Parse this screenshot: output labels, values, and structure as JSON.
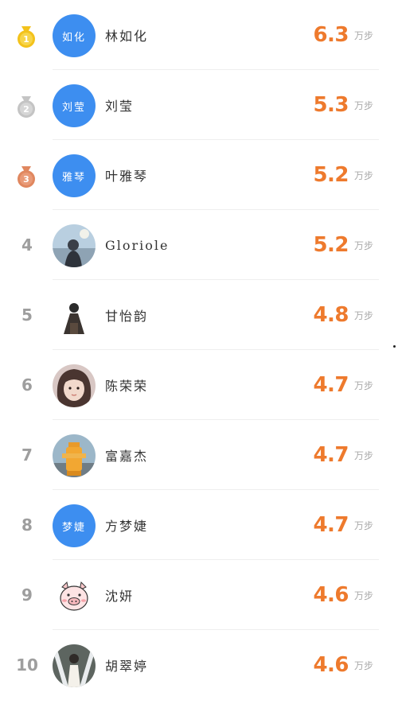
{
  "ranking": {
    "unit_label": "万步",
    "rows": [
      {
        "rank": "1",
        "medal": "gold",
        "avatar_text": "如化",
        "name": "林如化",
        "value": "6.3"
      },
      {
        "rank": "2",
        "medal": "silver",
        "avatar_text": "刘莹",
        "name": "刘莹",
        "value": "5.3"
      },
      {
        "rank": "3",
        "medal": "bronze",
        "avatar_text": "雅琴",
        "name": "叶雅琴",
        "value": "5.2"
      },
      {
        "rank": "4",
        "name": "Gloriole",
        "value": "5.2"
      },
      {
        "rank": "5",
        "name": "甘怡韵",
        "value": "4.8"
      },
      {
        "rank": "6",
        "name": "陈荣荣",
        "value": "4.7"
      },
      {
        "rank": "7",
        "name": "富嘉杰",
        "value": "4.7"
      },
      {
        "rank": "8",
        "avatar_text": "梦婕",
        "name": "方梦婕",
        "value": "4.7"
      },
      {
        "rank": "9",
        "name": "沈妍",
        "value": "4.6"
      },
      {
        "rank": "10",
        "name": "胡翠婷",
        "value": "4.6"
      }
    ]
  },
  "colors": {
    "value": "#ee7a2d",
    "avatar_blue": "#3d8ef0",
    "gold": "#f3c21b",
    "silver": "#c4c4c4",
    "bronze": "#e0875f"
  }
}
